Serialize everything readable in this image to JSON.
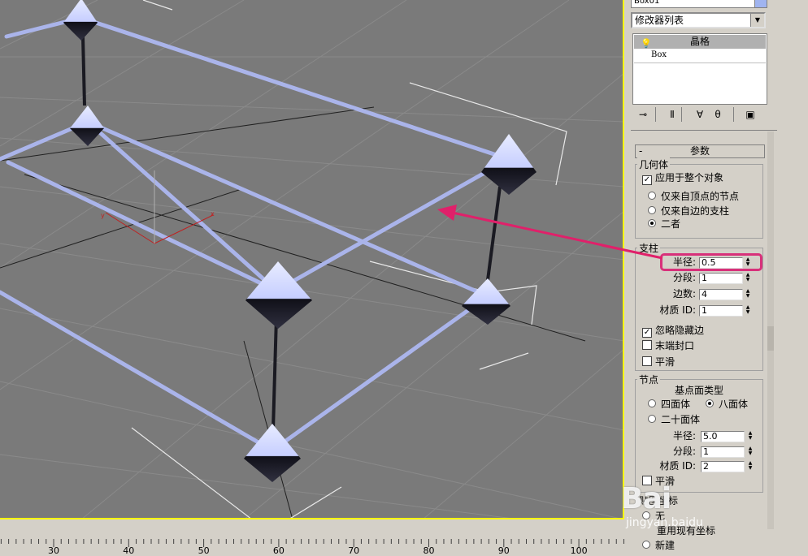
{
  "panel": {
    "object_name": "Box01",
    "modifier_list_label": "修改器列表",
    "stack_items": [
      "晶格",
      "Box"
    ],
    "params_title": "参数"
  },
  "geometry_group": {
    "label": "几何体",
    "apply_whole_label": "应用于整个对象",
    "radio_vertices": "仅来自顶点的节点",
    "radio_edges": "仅来自边的支柱",
    "radio_both": "二者"
  },
  "struts_group": {
    "label": "支柱",
    "radius_label": "半径:",
    "radius_value": "0.5",
    "segments_label": "分段:",
    "segments_value": "1",
    "sides_label": "边数:",
    "sides_value": "4",
    "matid_label": "材质 ID:",
    "matid_value": "1",
    "ignore_hidden_label": "忽略隐藏边",
    "end_caps_label": "末端封口",
    "smooth_label": "平滑"
  },
  "joints_group": {
    "label": "节点",
    "basetype_label": "基点面类型",
    "tetra_label": "四面体",
    "octa_label": "八面体",
    "icosa_label": "二十面体",
    "radius_label": "半径:",
    "radius_value": "5.0",
    "segments_label": "分段:",
    "segments_value": "1",
    "matid_label": "材质 ID:",
    "matid_value": "2",
    "smooth_label": "平滑"
  },
  "mapping_group": {
    "label": "贴图坐标",
    "none_label": "无",
    "existing_label": "重用现有坐标",
    "new_label": "新建"
  },
  "ruler": {
    "labels": [
      "30",
      "40",
      "50",
      "60",
      "70",
      "80",
      "90",
      "100"
    ]
  },
  "watermark": {
    "logo": "Bai",
    "sub": "jingyan.baidu"
  },
  "colors": {
    "viewport_bg": "#7a7a7a",
    "viewport_border": "#ffff00",
    "lattice_strut": "#a8b4ec",
    "highlight": "#d8307a",
    "arrow": "#e0206a"
  }
}
